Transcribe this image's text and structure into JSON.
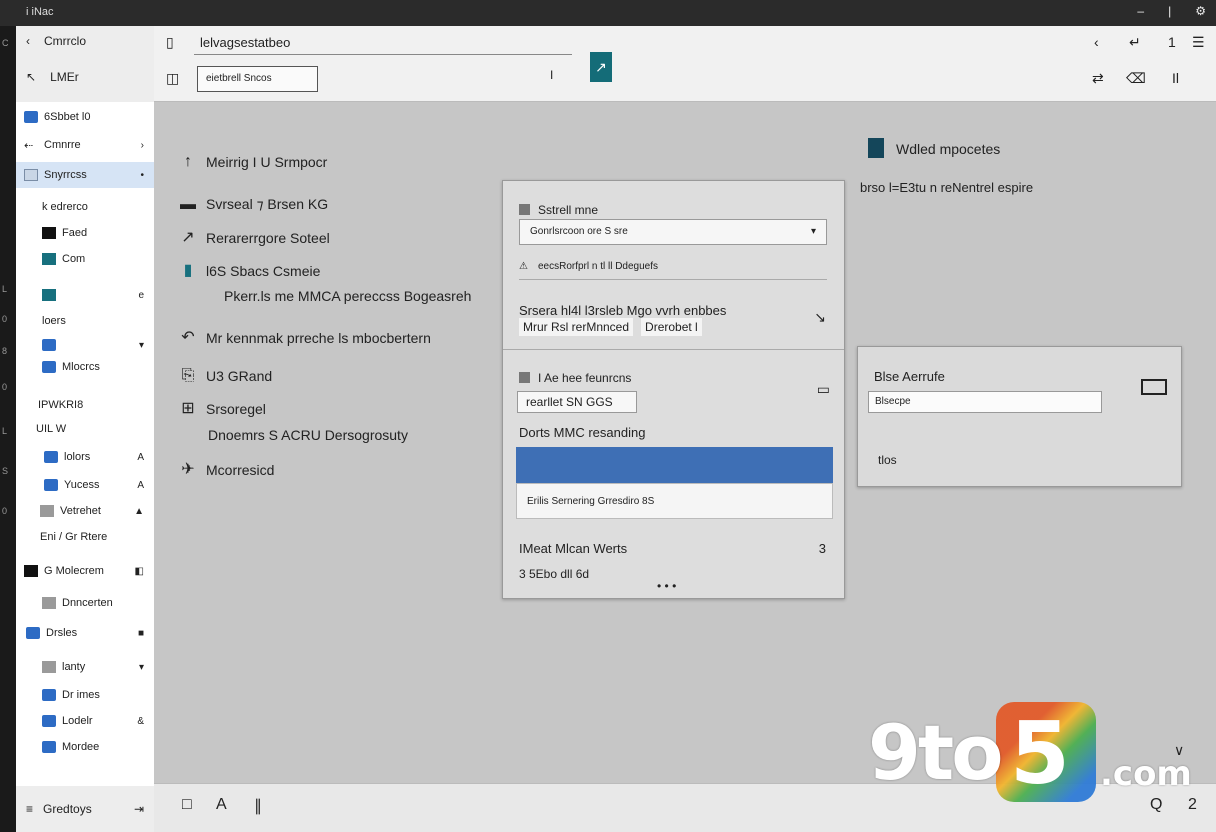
{
  "titlebar": {
    "title": "i iNac"
  },
  "edge_marks": [
    "C",
    "L",
    "0",
    "8",
    "0",
    "L",
    "S",
    "0"
  ],
  "sidebar": {
    "back_label": "Cmrrclo",
    "up_label": "LMEr",
    "items": [
      {
        "label": "6Sbbet l0",
        "icon": "blue",
        "trail": ""
      },
      {
        "label": "Cmnrre",
        "icon": "arrow",
        "trail": "›"
      },
      {
        "label": "Snyrrcss",
        "icon": "light",
        "trail": "•",
        "active": true
      },
      {
        "label": "k edrerco",
        "icon": "none",
        "trail": ""
      },
      {
        "label": "Faed",
        "icon": "dark",
        "trail": ""
      },
      {
        "label": "Com",
        "icon": "teal",
        "trail": ""
      },
      {
        "label": "",
        "icon": "teal",
        "trail": "e"
      },
      {
        "label": "loers",
        "icon": "none",
        "trail": ""
      },
      {
        "label": "",
        "icon": "blue",
        "trail": "▾"
      },
      {
        "label": "Mlocrcs",
        "icon": "blue",
        "trail": ""
      },
      {
        "label": "IPWKRI8",
        "icon": "none",
        "trail": ""
      },
      {
        "label": "UIL W",
        "icon": "none",
        "trail": ""
      },
      {
        "label": "lolors",
        "icon": "blue",
        "trail": "A"
      },
      {
        "label": "Yucess",
        "icon": "blue",
        "trail": "A"
      },
      {
        "label": "Vetrehet",
        "icon": "gray",
        "trail": "▲"
      },
      {
        "label": "Eni / Gr Rtere",
        "icon": "none",
        "trail": ""
      },
      {
        "label": "G Molecrem",
        "icon": "dark",
        "trail": "◧"
      },
      {
        "label": "Dnncerten",
        "icon": "gray",
        "trail": ""
      },
      {
        "label": "Drsles",
        "icon": "blue",
        "trail": "■"
      },
      {
        "label": "lanty",
        "icon": "gray",
        "trail": "▾"
      },
      {
        "label": "Dr imes",
        "icon": "blue",
        "trail": ""
      },
      {
        "label": "Lodelr",
        "icon": "blue",
        "trail": "&"
      },
      {
        "label": "Mordee",
        "icon": "blue",
        "trail": ""
      }
    ],
    "bottom_label": "Gredtoys"
  },
  "toolbar": {
    "address": "lelvagsestatbeo",
    "search_placeholder": "eietbrell Sncos",
    "cursor_mark": "I",
    "right_icons_top": [
      "‹",
      "↵",
      "1",
      "☰"
    ],
    "right_icons_bottom": [
      "⇄",
      "⌫",
      "Il"
    ]
  },
  "main": {
    "properties": [
      {
        "icon": "↑",
        "label": "Meirrig  I  U   Srmpocr"
      },
      {
        "icon": "▬",
        "label": "Svrseal  ⁊  Brsen          KG"
      },
      {
        "icon": "↗",
        "label": "Rerarerrgore Soteel"
      },
      {
        "icon": "▮",
        "label": "l6S Sbacs Csmeie"
      },
      {
        "icon": "↶",
        "label": "Mr kennmak prreche ls mbocbertern"
      },
      {
        "icon": "⎘",
        "label": "U3 GRand"
      },
      {
        "icon": "⊞",
        "label": "Srsoregel"
      },
      {
        "icon": "✈",
        "label": "Mcorresicd"
      }
    ],
    "sub_lines": [
      "Pkerr.ls me MMCA pereccss Bogeasreh",
      "Dnoemrs S ACRU Dersogrosuty"
    ]
  },
  "dialog": {
    "check1": "Sstrell mne",
    "dropdown1": "Gonrlsrcoon ore S sre",
    "warning": "eecsRorfprl n tl ll Ddeguefs",
    "heading2": "Srsera hl4l l3rsleb Mgo vvrh enbbes",
    "inline_a": "Mrur Rsl rerMnnced",
    "inline_b": "Drerobet l",
    "check2": "I Ae hee feunrcns",
    "input2": "rearllet SN GGS",
    "heading3": "Dorts  MMC  resanding",
    "bluebar_left": "",
    "bluebar_right": "",
    "strip": "Erilis    Sernering Grresdiro 8S",
    "footer_title": "IMeat Mlcan Werts",
    "footer_num": "3",
    "footer_sub": "3 5Ebo dll 6d"
  },
  "doc_header": {
    "title": "Wdled mpocetes",
    "subtitle": "brso l=E3tu n reNentrel espire"
  },
  "rpanel": {
    "title": "Blse  Aerrufe",
    "field": "Blsecpe",
    "footer": "tlos"
  },
  "bottombar": {
    "left_icons": [
      "□",
      "A",
      "∥"
    ],
    "right_icons": [
      "Q",
      "2"
    ],
    "chevron": "∨"
  },
  "watermark": {
    "part1": "9to",
    "part2": "5",
    "part3": ".com"
  }
}
